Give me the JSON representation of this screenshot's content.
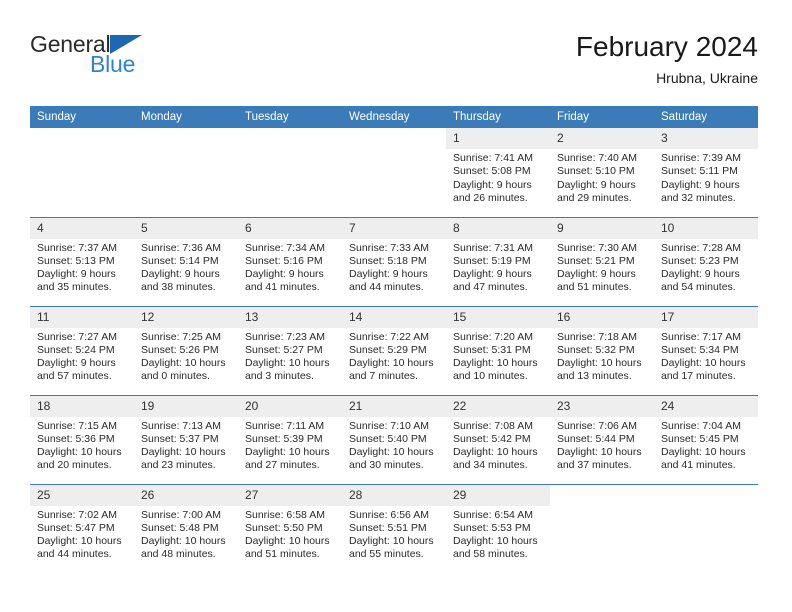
{
  "brand": {
    "name_part1": "General",
    "name_part2": "Blue",
    "triangle_color": "#1c68b3",
    "text_color_1": "#2b2b2b",
    "text_color_2": "#2f82d6"
  },
  "header": {
    "title": "February 2024",
    "subtitle": "Hrubna, Ukraine"
  },
  "theme": {
    "header_bg": "#3b7cb8",
    "header_text": "#ffffff",
    "daynum_bg": "#eeeeee",
    "cell_bg": "#ffffff",
    "separator": "#3b7cb8"
  },
  "weekdays": [
    "Sunday",
    "Monday",
    "Tuesday",
    "Wednesday",
    "Thursday",
    "Friday",
    "Saturday"
  ],
  "weeks": [
    [
      {
        "day": "",
        "blank": true,
        "sunrise": "",
        "sunset": "",
        "daylight1": "",
        "daylight2": ""
      },
      {
        "day": "",
        "blank": true,
        "sunrise": "",
        "sunset": "",
        "daylight1": "",
        "daylight2": ""
      },
      {
        "day": "",
        "blank": true,
        "sunrise": "",
        "sunset": "",
        "daylight1": "",
        "daylight2": ""
      },
      {
        "day": "",
        "blank": true,
        "sunrise": "",
        "sunset": "",
        "daylight1": "",
        "daylight2": ""
      },
      {
        "day": "1",
        "sunrise": "Sunrise: 7:41 AM",
        "sunset": "Sunset: 5:08 PM",
        "daylight1": "Daylight: 9 hours",
        "daylight2": "and 26 minutes."
      },
      {
        "day": "2",
        "sunrise": "Sunrise: 7:40 AM",
        "sunset": "Sunset: 5:10 PM",
        "daylight1": "Daylight: 9 hours",
        "daylight2": "and 29 minutes."
      },
      {
        "day": "3",
        "sunrise": "Sunrise: 7:39 AM",
        "sunset": "Sunset: 5:11 PM",
        "daylight1": "Daylight: 9 hours",
        "daylight2": "and 32 minutes."
      }
    ],
    [
      {
        "day": "4",
        "sunrise": "Sunrise: 7:37 AM",
        "sunset": "Sunset: 5:13 PM",
        "daylight1": "Daylight: 9 hours",
        "daylight2": "and 35 minutes."
      },
      {
        "day": "5",
        "sunrise": "Sunrise: 7:36 AM",
        "sunset": "Sunset: 5:14 PM",
        "daylight1": "Daylight: 9 hours",
        "daylight2": "and 38 minutes."
      },
      {
        "day": "6",
        "sunrise": "Sunrise: 7:34 AM",
        "sunset": "Sunset: 5:16 PM",
        "daylight1": "Daylight: 9 hours",
        "daylight2": "and 41 minutes."
      },
      {
        "day": "7",
        "sunrise": "Sunrise: 7:33 AM",
        "sunset": "Sunset: 5:18 PM",
        "daylight1": "Daylight: 9 hours",
        "daylight2": "and 44 minutes."
      },
      {
        "day": "8",
        "sunrise": "Sunrise: 7:31 AM",
        "sunset": "Sunset: 5:19 PM",
        "daylight1": "Daylight: 9 hours",
        "daylight2": "and 47 minutes."
      },
      {
        "day": "9",
        "sunrise": "Sunrise: 7:30 AM",
        "sunset": "Sunset: 5:21 PM",
        "daylight1": "Daylight: 9 hours",
        "daylight2": "and 51 minutes."
      },
      {
        "day": "10",
        "sunrise": "Sunrise: 7:28 AM",
        "sunset": "Sunset: 5:23 PM",
        "daylight1": "Daylight: 9 hours",
        "daylight2": "and 54 minutes."
      }
    ],
    [
      {
        "day": "11",
        "sunrise": "Sunrise: 7:27 AM",
        "sunset": "Sunset: 5:24 PM",
        "daylight1": "Daylight: 9 hours",
        "daylight2": "and 57 minutes."
      },
      {
        "day": "12",
        "sunrise": "Sunrise: 7:25 AM",
        "sunset": "Sunset: 5:26 PM",
        "daylight1": "Daylight: 10 hours",
        "daylight2": "and 0 minutes."
      },
      {
        "day": "13",
        "sunrise": "Sunrise: 7:23 AM",
        "sunset": "Sunset: 5:27 PM",
        "daylight1": "Daylight: 10 hours",
        "daylight2": "and 3 minutes."
      },
      {
        "day": "14",
        "sunrise": "Sunrise: 7:22 AM",
        "sunset": "Sunset: 5:29 PM",
        "daylight1": "Daylight: 10 hours",
        "daylight2": "and 7 minutes."
      },
      {
        "day": "15",
        "sunrise": "Sunrise: 7:20 AM",
        "sunset": "Sunset: 5:31 PM",
        "daylight1": "Daylight: 10 hours",
        "daylight2": "and 10 minutes."
      },
      {
        "day": "16",
        "sunrise": "Sunrise: 7:18 AM",
        "sunset": "Sunset: 5:32 PM",
        "daylight1": "Daylight: 10 hours",
        "daylight2": "and 13 minutes."
      },
      {
        "day": "17",
        "sunrise": "Sunrise: 7:17 AM",
        "sunset": "Sunset: 5:34 PM",
        "daylight1": "Daylight: 10 hours",
        "daylight2": "and 17 minutes."
      }
    ],
    [
      {
        "day": "18",
        "sunrise": "Sunrise: 7:15 AM",
        "sunset": "Sunset: 5:36 PM",
        "daylight1": "Daylight: 10 hours",
        "daylight2": "and 20 minutes."
      },
      {
        "day": "19",
        "sunrise": "Sunrise: 7:13 AM",
        "sunset": "Sunset: 5:37 PM",
        "daylight1": "Daylight: 10 hours",
        "daylight2": "and 23 minutes."
      },
      {
        "day": "20",
        "sunrise": "Sunrise: 7:11 AM",
        "sunset": "Sunset: 5:39 PM",
        "daylight1": "Daylight: 10 hours",
        "daylight2": "and 27 minutes."
      },
      {
        "day": "21",
        "sunrise": "Sunrise: 7:10 AM",
        "sunset": "Sunset: 5:40 PM",
        "daylight1": "Daylight: 10 hours",
        "daylight2": "and 30 minutes."
      },
      {
        "day": "22",
        "sunrise": "Sunrise: 7:08 AM",
        "sunset": "Sunset: 5:42 PM",
        "daylight1": "Daylight: 10 hours",
        "daylight2": "and 34 minutes."
      },
      {
        "day": "23",
        "sunrise": "Sunrise: 7:06 AM",
        "sunset": "Sunset: 5:44 PM",
        "daylight1": "Daylight: 10 hours",
        "daylight2": "and 37 minutes."
      },
      {
        "day": "24",
        "sunrise": "Sunrise: 7:04 AM",
        "sunset": "Sunset: 5:45 PM",
        "daylight1": "Daylight: 10 hours",
        "daylight2": "and 41 minutes."
      }
    ],
    [
      {
        "day": "25",
        "sunrise": "Sunrise: 7:02 AM",
        "sunset": "Sunset: 5:47 PM",
        "daylight1": "Daylight: 10 hours",
        "daylight2": "and 44 minutes."
      },
      {
        "day": "26",
        "sunrise": "Sunrise: 7:00 AM",
        "sunset": "Sunset: 5:48 PM",
        "daylight1": "Daylight: 10 hours",
        "daylight2": "and 48 minutes."
      },
      {
        "day": "27",
        "sunrise": "Sunrise: 6:58 AM",
        "sunset": "Sunset: 5:50 PM",
        "daylight1": "Daylight: 10 hours",
        "daylight2": "and 51 minutes."
      },
      {
        "day": "28",
        "sunrise": "Sunrise: 6:56 AM",
        "sunset": "Sunset: 5:51 PM",
        "daylight1": "Daylight: 10 hours",
        "daylight2": "and 55 minutes."
      },
      {
        "day": "29",
        "sunrise": "Sunrise: 6:54 AM",
        "sunset": "Sunset: 5:53 PM",
        "daylight1": "Daylight: 10 hours",
        "daylight2": "and 58 minutes."
      },
      {
        "day": "",
        "blank": true,
        "sunrise": "",
        "sunset": "",
        "daylight1": "",
        "daylight2": ""
      },
      {
        "day": "",
        "blank": true,
        "sunrise": "",
        "sunset": "",
        "daylight1": "",
        "daylight2": ""
      }
    ]
  ]
}
